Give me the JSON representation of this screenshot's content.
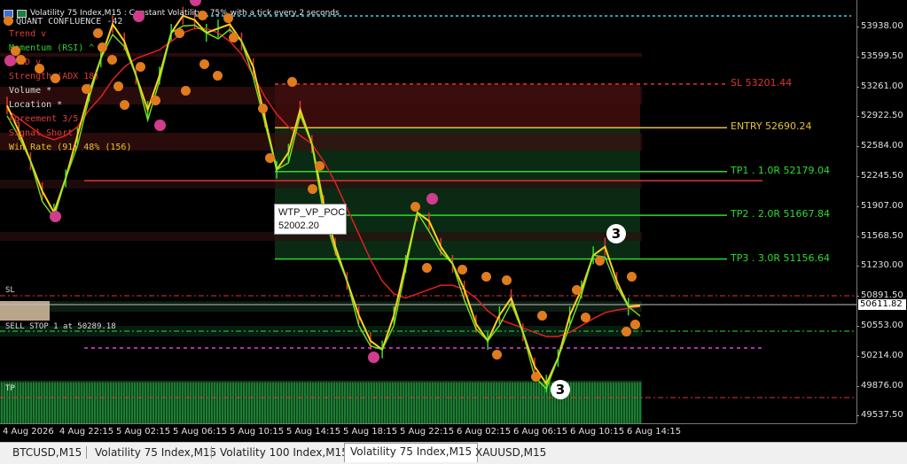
{
  "window": {
    "title": "Volatility 75 Index,M15 : Constant Volatility - 75% with a tick every 2 seconds",
    "icons": [
      "chart-window-icon",
      "chart-type-icon"
    ]
  },
  "overlay": {
    "header": "QUANT CONFLUENCE -42",
    "rows": [
      {
        "text": "Trend v",
        "color": "#e23b3b"
      },
      {
        "text": "Momentum (RSI) ^",
        "color": "#2bd12b"
      },
      {
        "text": "MACD v",
        "color": "#e23b3b"
      },
      {
        "text": "Strength (ADX 18)",
        "color": "#e23b3b"
      },
      {
        "text": "Volume *",
        "color": "#d9d9d9"
      },
      {
        "text": "Location *",
        "color": "#d9d9d9"
      },
      {
        "text": "Agreement 3/5",
        "color": "#e23b3b"
      },
      {
        "text": "Signal Short",
        "color": "#e23b3b"
      },
      {
        "text": "Win Rate (91) 48% (156)",
        "color": "#e6c22e"
      }
    ]
  },
  "levels": {
    "sl": {
      "label": "SL 53201.44",
      "price": 53201.44,
      "color": "#e03333"
    },
    "entry": {
      "label": "ENTRY 52690.24",
      "price": 52690.24,
      "color": "#e6c22e"
    },
    "tp1": {
      "label": "TP1 . 1.0R 52179.04",
      "price": 52179.04,
      "color": "#2cdc2c"
    },
    "tp2": {
      "label": "TP2 . 2.0R 51667.84",
      "price": 51667.84,
      "color": "#2cdc2c"
    },
    "tp3": {
      "label": "TP3 . 3.0R 51156.64",
      "price": 51156.64,
      "color": "#2cdc2c"
    },
    "sl_tag": "SL",
    "sell_stop": "SELL STOP 1 at 50289.18",
    "tp_tag": "TP"
  },
  "poc": {
    "title": "WTP_VP_POC",
    "value": "52002.20"
  },
  "wave_labels": {
    "peak3": "3",
    "trough3": "3"
  },
  "price_axis": {
    "ticks": [
      "53938.00",
      "53599.50",
      "53261.00",
      "52922.50",
      "52584.00",
      "52245.50",
      "51907.00",
      "51568.50",
      "51230.00",
      "50891.50",
      "50553.00",
      "50214.00",
      "49876.00",
      "49537.50"
    ],
    "current": "50611.82",
    "range": [
      49320,
      54080
    ]
  },
  "time_axis": {
    "labels": [
      "4 Aug 2026",
      "4 Aug 22:15",
      "5 Aug 02:15",
      "5 Aug 06:15",
      "5 Aug 10:15",
      "5 Aug 14:15",
      "5 Aug 18:15",
      "5 Aug 22:15",
      "6 Aug 02:15",
      "6 Aug 06:15",
      "6 Aug 10:15",
      "6 Aug 14:15"
    ]
  },
  "tabs": [
    {
      "label": "BTCUSD,M15",
      "active": false
    },
    {
      "label": "Volatility 75 Index,M15",
      "active": false
    },
    {
      "label": "Volatility 100 Index,M15",
      "active": false
    },
    {
      "label": "Volatility 75 Index,M15",
      "active": true
    },
    {
      "label": "XAUUSD,M15",
      "active": false
    }
  ],
  "chart_data": {
    "type": "line",
    "title": "",
    "price_range": [
      49320,
      54080
    ],
    "series": [
      {
        "values": [
          52950,
          52650,
          52300,
          51950,
          51700,
          52100,
          52600,
          53100,
          53500,
          53900,
          53700,
          53300,
          52900,
          53300,
          53800,
          54000,
          53950,
          53800,
          53850,
          53900,
          53700,
          53400,
          52800,
          52200,
          52400,
          52900,
          52500,
          51800,
          51300,
          50900,
          50500,
          50200,
          50100,
          50500,
          51100,
          51700,
          51600,
          51300,
          51100,
          50800,
          50400,
          50200,
          50500,
          50700,
          50300,
          49900,
          49700,
          50000,
          50500,
          50800,
          51200,
          51300,
          50900,
          50600,
          50611
        ]
      },
      {
        "values": [
          52900,
          52800,
          52700,
          52600,
          52550,
          52600,
          52700,
          52900,
          53050,
          53250,
          53400,
          53500,
          53550,
          53600,
          53700,
          53800,
          53850,
          53850,
          53800,
          53700,
          53550,
          53300,
          53050,
          52850,
          52700,
          52600,
          52500,
          52300,
          52050,
          51750,
          51450,
          51150,
          50900,
          50750,
          50700,
          50750,
          50800,
          50850,
          50850,
          50800,
          50700,
          50550,
          50450,
          50400,
          50350,
          50300,
          50250,
          50250,
          50300,
          50380,
          50460,
          50530,
          50560,
          50580,
          50600
        ]
      }
    ]
  }
}
